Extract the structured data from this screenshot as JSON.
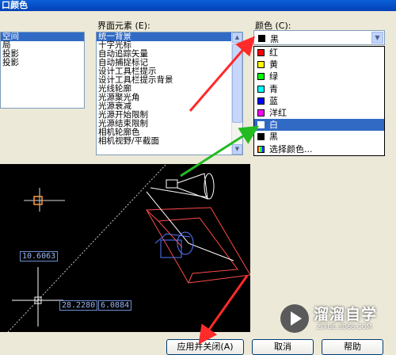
{
  "title": "口颜色",
  "context": {
    "items": [
      "空间",
      "局",
      "投影",
      "投影"
    ],
    "selected_index": 0
  },
  "interface_elements": {
    "label": "界面元素 (E):",
    "items": [
      "统一背景",
      "十字光标",
      "自动追踪矢量",
      "自动捕捉标记",
      "设计工具栏提示",
      "设计工具栏提示背景",
      "光线轮廓",
      "光源聚光角",
      "光源衰减",
      "光源开始限制",
      "光源结束限制",
      "相机轮廓色",
      "相机视野/平截面"
    ],
    "selected_index": 0
  },
  "color": {
    "label": "颜色 (C):",
    "current": {
      "name": "黑",
      "swatch": "#000000"
    },
    "options": [
      {
        "name": "红",
        "swatch": "#ff0000"
      },
      {
        "name": "黄",
        "swatch": "#ffff00"
      },
      {
        "name": "绿",
        "swatch": "#00ff00"
      },
      {
        "name": "青",
        "swatch": "#00ffff"
      },
      {
        "name": "蓝",
        "swatch": "#0000ff"
      },
      {
        "name": "洋红",
        "swatch": "#ff00ff"
      },
      {
        "name": "白",
        "swatch": "#ffffff"
      },
      {
        "name": "黑",
        "swatch": "#000000"
      },
      {
        "name": "选择颜色...",
        "swatch": "multicolor"
      }
    ],
    "highlighted_index": 6
  },
  "preview": {
    "coord_value": "10.6063",
    "coord_x": "28.2280",
    "coord_y": "6.0884"
  },
  "buttons": {
    "apply": "应用并关闭(A)",
    "cancel": "取消",
    "help": "帮助"
  },
  "watermark": {
    "brand": "溜溜自学",
    "url": "ZIXUE.3D66.COM"
  }
}
